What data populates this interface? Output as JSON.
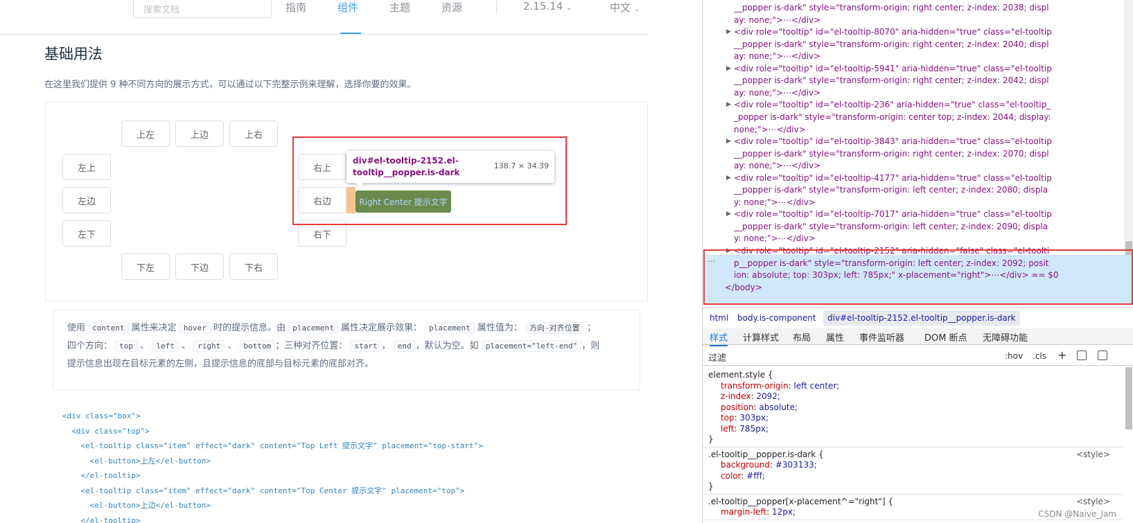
{
  "header": {
    "search_placeholder": "搜索文档",
    "nav": [
      "指南",
      "组件",
      "主题",
      "资源"
    ],
    "version": "2.15.14",
    "language": "中文"
  },
  "section": {
    "title": "基础用法",
    "description": "在这里我们提供 9 种不同方向的展示方式，可以通过以下完整示例来理解，选择你要的效果。"
  },
  "demo": {
    "top_buttons": [
      "上左",
      "上边",
      "上右"
    ],
    "left_buttons": [
      "左上",
      "左边",
      "左下"
    ],
    "right_buttons": [
      "右上",
      "右边",
      "右下"
    ],
    "bottom_buttons": [
      "下左",
      "下边",
      "下右"
    ],
    "tooltip_text": "Right Center 提示文字",
    "inspect_selector": "div#el-tooltip-2152.el-tooltip__popper.is-dark",
    "inspect_size": "138.7 × 34.39"
  },
  "tip": {
    "p1": "使用",
    "c1": "content",
    "p2": "属性来决定",
    "c2": "hover",
    "p3": "时的提示信息。由",
    "c3": "placement",
    "p4": "属性决定展示效果：",
    "c4": "placement",
    "p5": "属性值为：",
    "c5": "方向-对齐位置",
    "p6": "；",
    "p7": "四个方向：",
    "c6": "top",
    "sep1": "、",
    "c7": "left",
    "sep2": "、",
    "c8": "right",
    "sep3": "、",
    "c9": "bottom",
    "p8": "；三种对齐位置：",
    "c10": "start",
    "sep4": "，",
    "c11": "end",
    "p9": "，默认为空。如",
    "c12": "placement=\"left-end\"",
    "p10": "，则",
    "p11": "提示信息出现在目标元素的左侧，且提示信息的底部与目标元素的底部对齐。"
  },
  "code_lines": [
    "<div class=\"box\">",
    "  <div class=\"top\">",
    "    <el-tooltip class=\"item\" effect=\"dark\" content=\"Top Left 提示文字\" placement=\"top-start\">",
    "      <el-button>上左</el-button>",
    "    </el-tooltip>",
    "    <el-tooltip class=\"item\" effect=\"dark\" content=\"Top Center 提示文字\" placement=\"top\">",
    "      <el-button>上边</el-button>",
    "    </el-tooltip>"
  ],
  "devtools": {
    "dom_lines": [
      "__popper is-dark\" style=\"transform-origin: right center; z-index: 2038; displ",
      "ay: none;\">⋯</div>",
      "<div role=\"tooltip\" id=\"el-tooltip-8070\" aria-hidden=\"true\" class=\"el-tooltip",
      "__popper is-dark\" style=\"transform-origin: right center; z-index: 2040; displ",
      "ay: none;\">⋯</div>",
      "<div role=\"tooltip\" id=\"el-tooltip-5941\" aria-hidden=\"true\" class=\"el-tooltip",
      "__popper is-dark\" style=\"transform-origin: right center; z-index: 2042; displ",
      "ay: none;\">⋯</div>",
      "<div role=\"tooltip\" id=\"el-tooltip-236\" aria-hidden=\"true\" class=\"el-tooltip_",
      "_popper is-dark\" style=\"transform-origin: center top; z-index: 2044; display:",
      "none;\">⋯</div>",
      "<div role=\"tooltip\" id=\"el-tooltip-3843\" aria-hidden=\"true\" class=\"el-tooltip",
      "__popper is-dark\" style=\"transform-origin: right center; z-index: 2070; displ",
      "ay: none;\">⋯</div>",
      "<div role=\"tooltip\" id=\"el-tooltip-4177\" aria-hidden=\"true\" class=\"el-tooltip",
      "__popper is-dark\" style=\"transform-origin: left center; z-index: 2080; displa",
      "y: none;\">⋯</div>",
      "<div role=\"tooltip\" id=\"el-tooltip-7017\" aria-hidden=\"true\" class=\"el-tooltip",
      "__popper is-dark\" style=\"transform-origin: left center; z-index: 2090; displa",
      "y: none;\">⋯</div>",
      "<div role=\"tooltip\" id=\"el-tooltip-2152\" aria-hidden=\"false\" class=\"el-toolti",
      "p__popper is-dark\" style=\"transform-origin: left center; z-index: 2092; posit",
      "ion: absolute; top: 303px; left: 785px;\" x-placement=\"right\">⋯</div> == $0",
      "</body>"
    ],
    "breadcrumb": [
      "html",
      "body.is-component",
      "div#el-tooltip-2152.el-tooltip__popper.is-dark"
    ],
    "tabs": [
      "样式",
      "计算样式",
      "布局",
      "属性",
      "事件监听器",
      "DOM 断点",
      "无障碍功能"
    ],
    "filter_placeholder": "过滤",
    "filter_tools": [
      ":hov",
      ".cls",
      "+"
    ],
    "element_style": {
      "selector": "element.style {",
      "props": [
        [
          "transform-origin",
          "left center;"
        ],
        [
          "z-index",
          "2092;"
        ],
        [
          "position",
          "absolute;"
        ],
        [
          "top",
          "303px;"
        ],
        [
          "left",
          "785px;"
        ]
      ],
      "close": "}"
    },
    "rule2": {
      "selector": ".el-tooltip__popper.is-dark {",
      "source": "<style>",
      "props": [
        [
          "background",
          "#303133;"
        ],
        [
          "color",
          "#fff;"
        ]
      ],
      "close": "}"
    },
    "rule3": {
      "selector": ".el-tooltip__popper[x-placement^=\"right\"] {",
      "source": "<style>",
      "props": [
        [
          "margin-left",
          "12px;"
        ]
      ]
    },
    "watermark": "CSDN @Naive_Jam"
  }
}
